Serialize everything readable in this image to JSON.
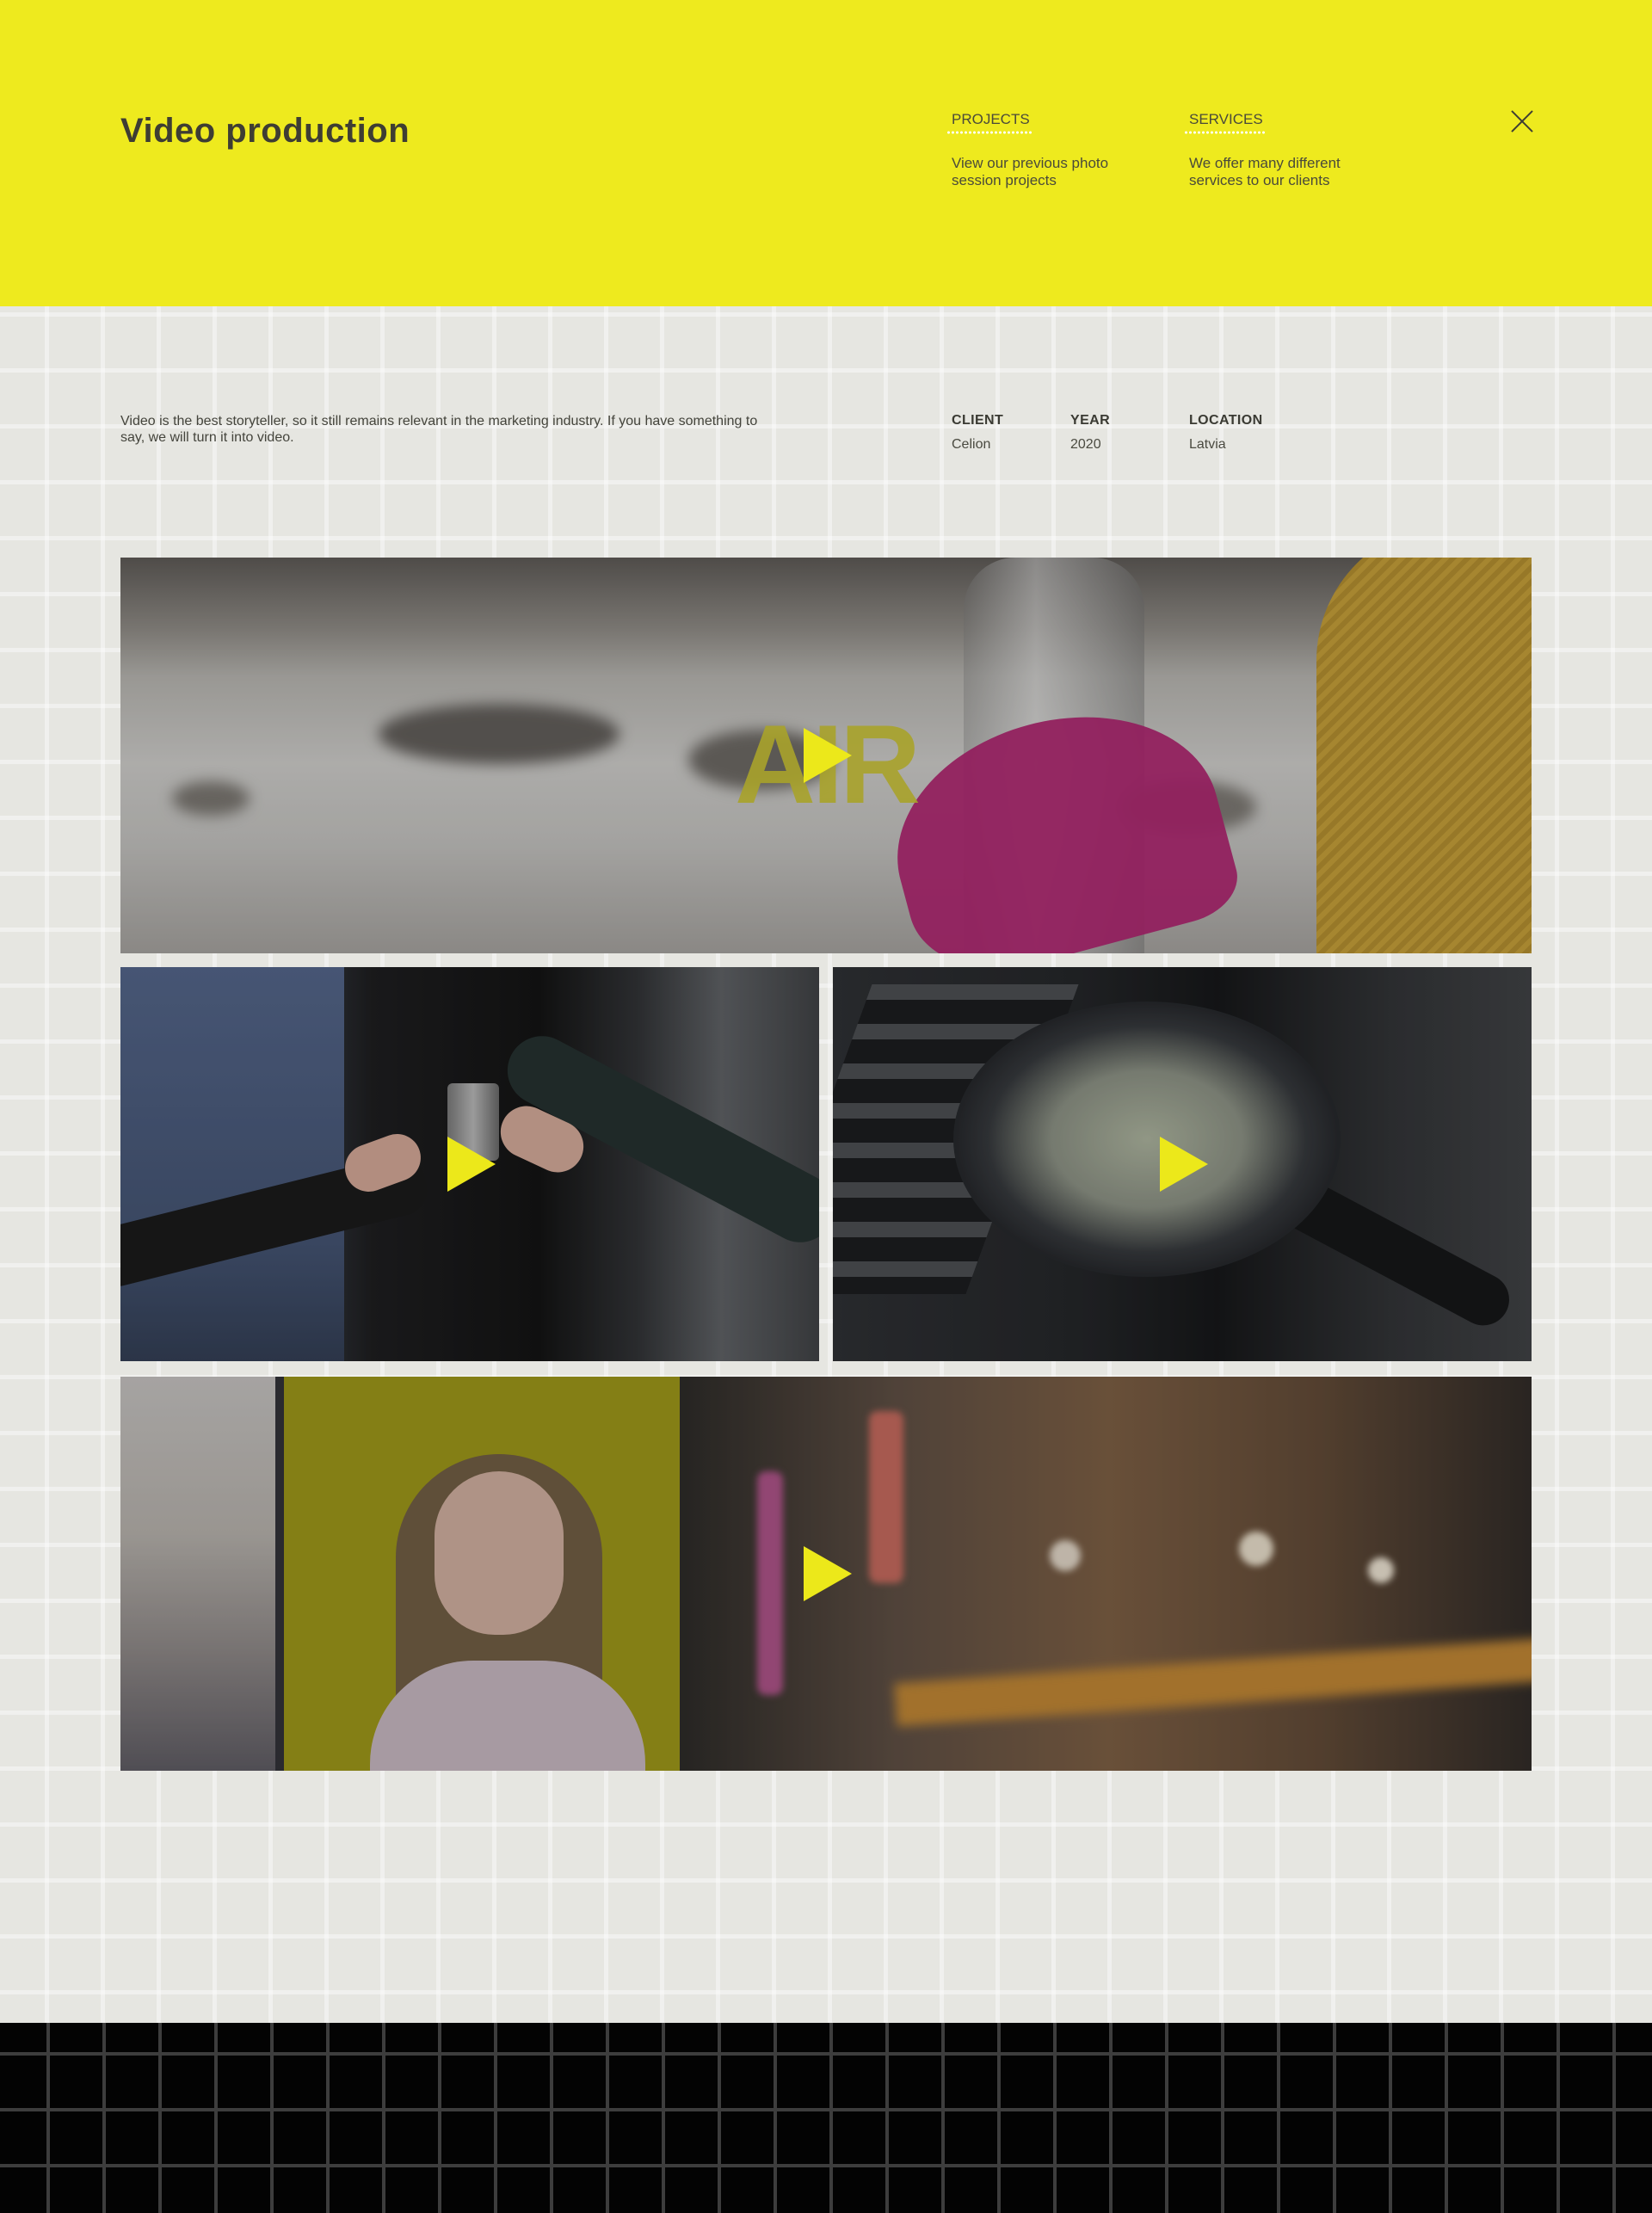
{
  "header": {
    "title": "Video production",
    "nav": [
      {
        "label": "PROJECTS",
        "description": "View our previous photo session projects"
      },
      {
        "label": "SERVICES",
        "description": "We offer many different services to our clients"
      }
    ],
    "close_icon": "close-icon"
  },
  "main": {
    "intro": "Video is the best storyteller, so it still remains relevant in the marketing industry. If you have something to say, we will turn it into video.",
    "meta": {
      "client": {
        "label": "CLIENT",
        "value": "Celion"
      },
      "year": {
        "label": "YEAR",
        "value": "2020"
      },
      "location": {
        "label": "LOCATION",
        "value": "Latvia"
      }
    },
    "videos": [
      {
        "overlay_text": "AIR",
        "icon": "play-icon"
      },
      {
        "icon": "play-icon"
      },
      {
        "icon": "play-icon"
      },
      {
        "icon": "play-icon"
      }
    ]
  },
  "colors": {
    "accent": "#eeea1e",
    "background": "#e6e6e1",
    "footer": "#030303",
    "text": "#3e3d33"
  }
}
